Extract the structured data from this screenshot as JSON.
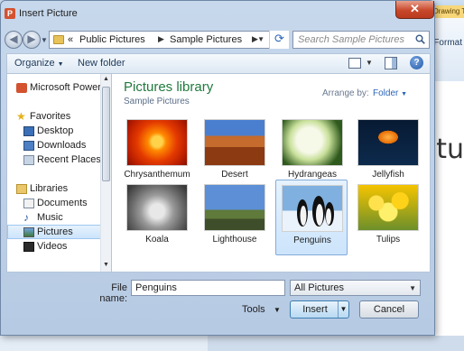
{
  "background_app": {
    "contextual_tab": "Drawing Too",
    "format_tab": "Format",
    "slide_text": "ctu"
  },
  "dialog": {
    "title": "Insert Picture",
    "close_glyph": "✕",
    "app_icon_letter": "P"
  },
  "address": {
    "prefix": "«",
    "crumbs": [
      "Public Pictures",
      "Sample Pictures"
    ],
    "search_placeholder": "Search Sample Pictures"
  },
  "toolbar": {
    "organize": "Organize",
    "new_folder": "New folder"
  },
  "nav": {
    "items": [
      {
        "label": "Microsoft PowerPoi",
        "icon": "powerpoint-icon"
      },
      {
        "label": "Favorites",
        "icon": "star-icon"
      },
      {
        "label": "Desktop",
        "icon": "desktop-icon"
      },
      {
        "label": "Downloads",
        "icon": "downloads-icon"
      },
      {
        "label": "Recent Places",
        "icon": "recent-places-icon"
      },
      {
        "label": "Libraries",
        "icon": "libraries-icon"
      },
      {
        "label": "Documents",
        "icon": "documents-icon"
      },
      {
        "label": "Music",
        "icon": "music-icon"
      },
      {
        "label": "Pictures",
        "icon": "pictures-icon"
      },
      {
        "label": "Videos",
        "icon": "videos-icon"
      }
    ],
    "selected": "Pictures"
  },
  "library": {
    "title": "Pictures library",
    "subtitle": "Sample Pictures",
    "arrange_label": "Arrange by:",
    "arrange_value": "Folder"
  },
  "pictures": [
    {
      "name": "Chrysanthemum"
    },
    {
      "name": "Desert"
    },
    {
      "name": "Hydrangeas"
    },
    {
      "name": "Jellyfish"
    },
    {
      "name": "Koala"
    },
    {
      "name": "Lighthouse"
    },
    {
      "name": "Penguins"
    },
    {
      "name": "Tulips"
    }
  ],
  "selected_picture": "Penguins",
  "footer": {
    "filename_label": "File name:",
    "filename_value": "Penguins",
    "filetype_value": "All Pictures",
    "tools_label": "Tools",
    "insert_label": "Insert",
    "cancel_label": "Cancel"
  }
}
